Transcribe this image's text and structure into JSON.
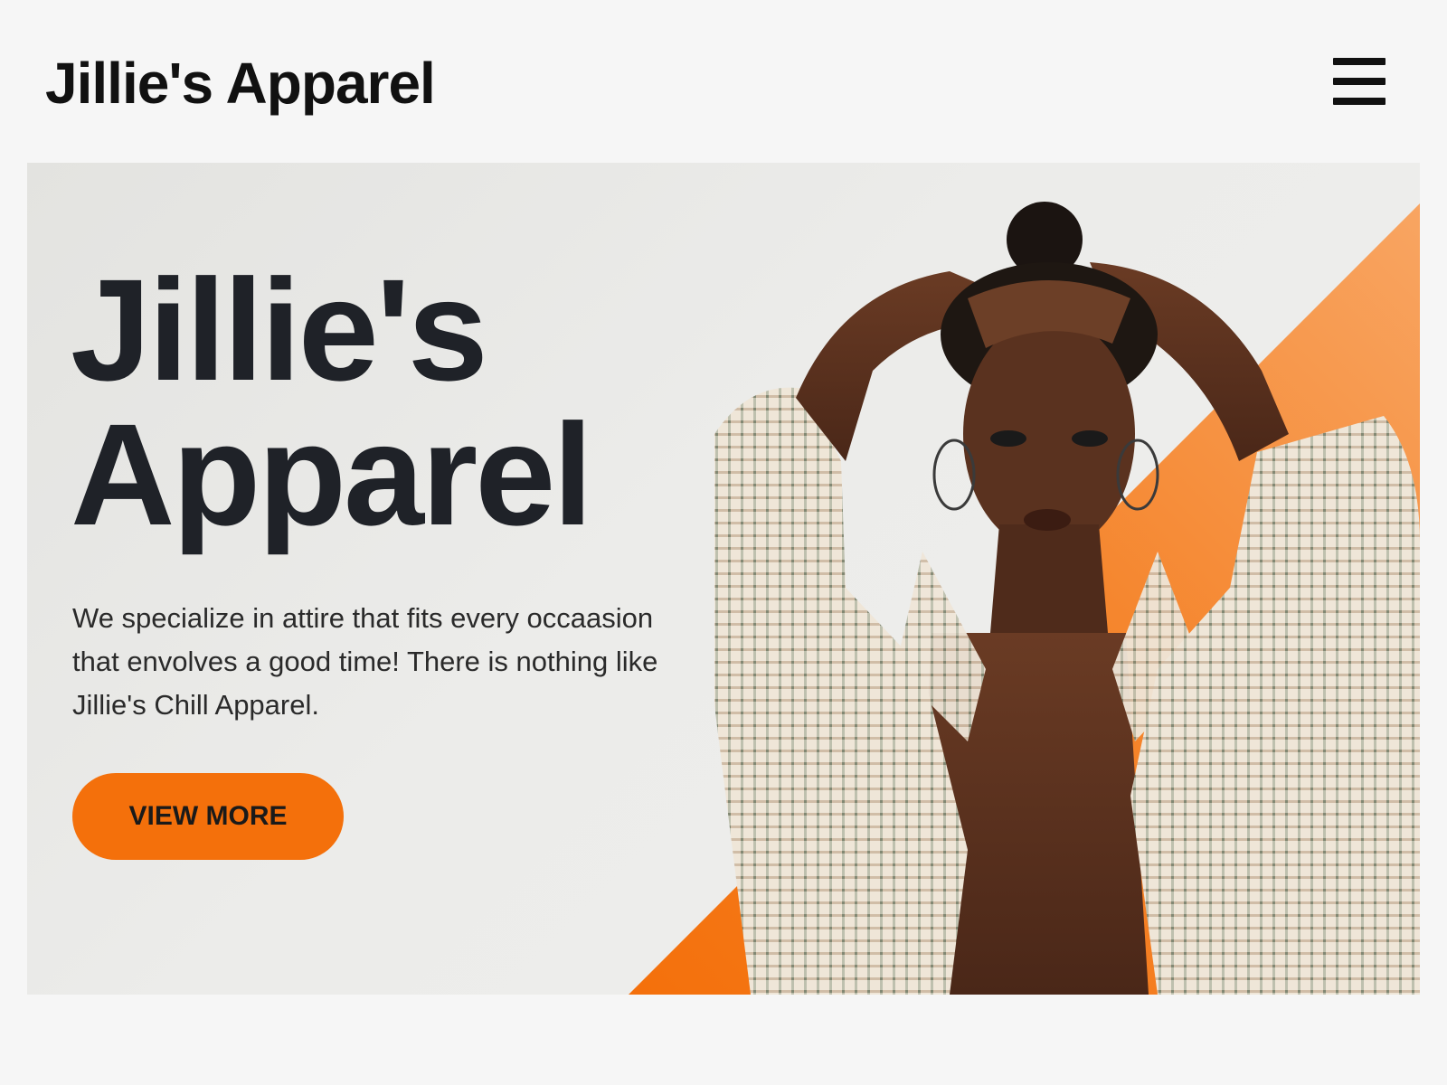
{
  "header": {
    "brand": "Jillie's Apparel",
    "menu_icon": "hamburger-menu-icon"
  },
  "hero": {
    "title_line1": "Jillie's",
    "title_line2": "Apparel",
    "description": "We specialize in attire that fits every occaasion that envolves a good time! There is nothing like Jillie's Chill Apparel.",
    "cta_label": "VIEW MORE",
    "image": "model-in-checked-jacket-photo"
  },
  "colors": {
    "accent": "#f4700b",
    "accent_light": "#f7a460",
    "text_dark": "#1f2228",
    "background": "#f6f6f6",
    "hero_background": "#e8e8e6"
  }
}
